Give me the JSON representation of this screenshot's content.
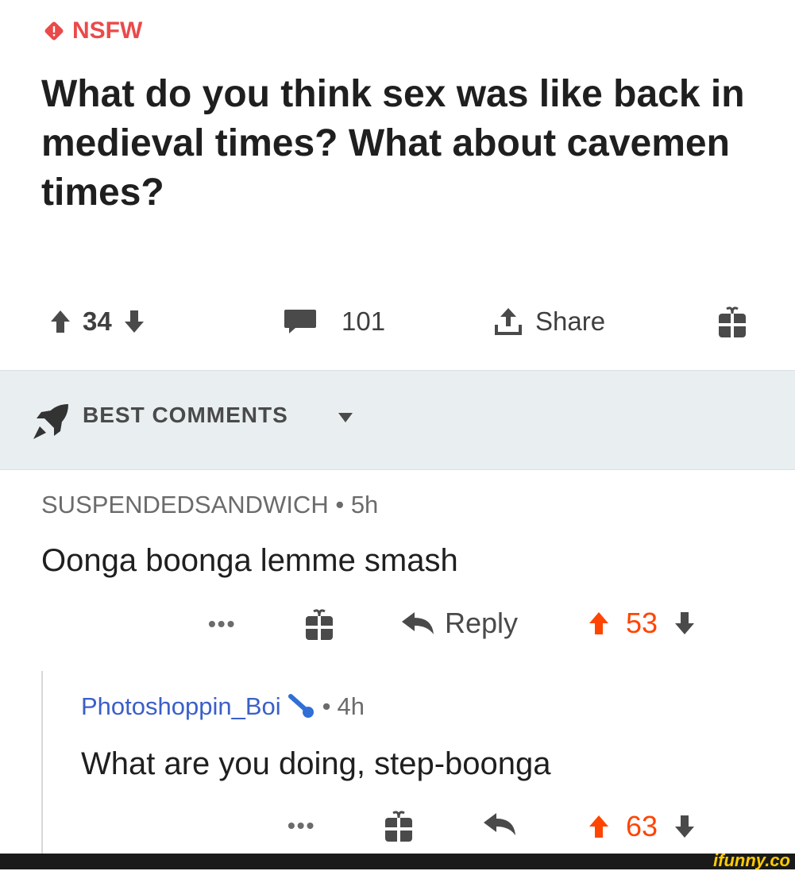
{
  "post": {
    "flair": "NSFW",
    "title": "What do you think sex was like back in medieval times? What about cavemen times?",
    "score": "34",
    "comments": "101",
    "share_label": "Share"
  },
  "sort": {
    "label": "BEST COMMENTS"
  },
  "comments": [
    {
      "author": "SUSPENDEDSANDWICH",
      "age": "5h",
      "text": "Oonga boonga lemme smash",
      "more": "•••",
      "reply_label": "Reply",
      "score": "53"
    },
    {
      "author": "Photoshoppin_Boi",
      "age": "4h",
      "text": "What are you doing, step-boonga",
      "more": "•••",
      "score": "63"
    }
  ],
  "watermark": "ifunny.co",
  "colors": {
    "nsfw": "#ea4a4a",
    "upvote_active": "#ff4500",
    "link_author": "#3a5fc8",
    "sort_bg": "#e9eef0"
  }
}
